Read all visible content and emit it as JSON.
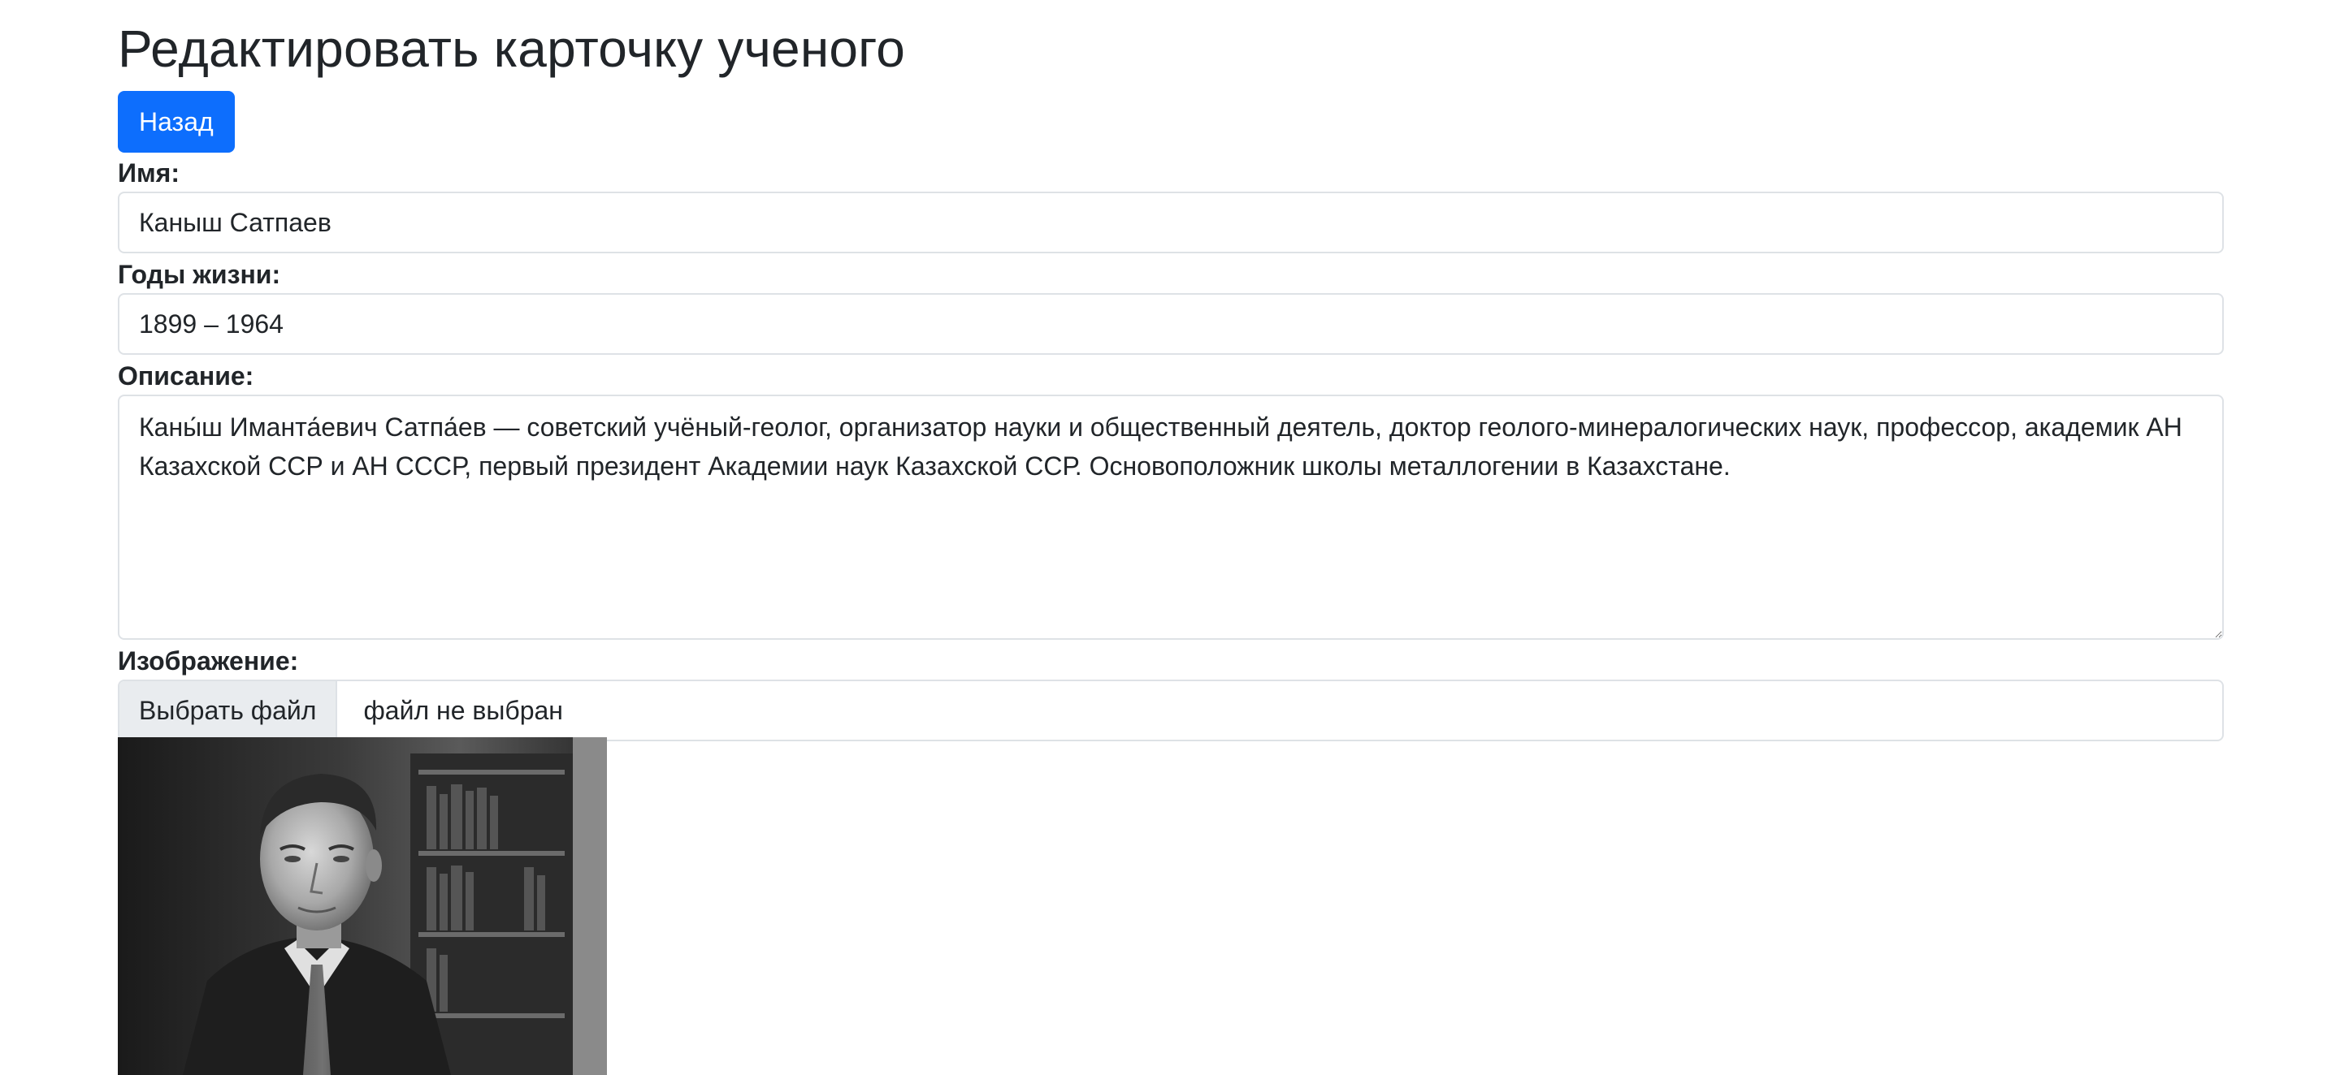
{
  "page": {
    "title": "Редактировать карточку ученого"
  },
  "actions": {
    "back_label": "Назад"
  },
  "form": {
    "name": {
      "label": "Имя:",
      "value": "Каныш Сатпаев"
    },
    "years": {
      "label": "Годы жизни:",
      "value": "1899 – 1964"
    },
    "description": {
      "label": "Описание:",
      "value": "Каны́ш Иманта́евич Сатпа́ев — советский учёный-геолог, организатор науки и общественный деятель, доктор геолого-минералогических наук, профессор, академик АН Казахской ССР и АН СССР, первый президент Академии наук Казахской ССР. Основоположник школы металлогении в Казахстане."
    },
    "image": {
      "label": "Изображение:",
      "choose_button": "Выбрать файл",
      "status": "файл не выбран"
    }
  }
}
